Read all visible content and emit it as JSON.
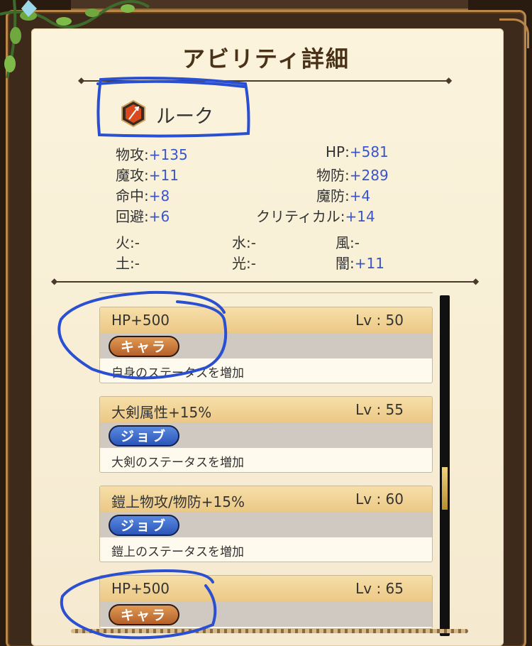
{
  "title": "アビリティ詳細",
  "character": {
    "name": "ルーク",
    "icon": "weapon-emblem-icon"
  },
  "stats_left": [
    {
      "label": "物攻:",
      "value": "+135"
    },
    {
      "label": "魔攻:",
      "value": "+11"
    },
    {
      "label": "命中:",
      "value": "+8"
    },
    {
      "label": "回避:",
      "value": "+6"
    }
  ],
  "stats_right": [
    {
      "label": "HP:",
      "value": "+581"
    },
    {
      "label": "物防:",
      "value": "+289"
    },
    {
      "label": "魔防:",
      "value": "+4"
    },
    {
      "label": "クリティカル:",
      "value": "+14"
    }
  ],
  "elements": [
    {
      "label": "火:",
      "value": "-"
    },
    {
      "label": "水:",
      "value": "-"
    },
    {
      "label": "風:",
      "value": "-"
    },
    {
      "label": "土:",
      "value": "-"
    },
    {
      "label": "光:",
      "value": "-"
    },
    {
      "label": "闇:",
      "value": "+11"
    }
  ],
  "abilities": [
    {
      "name": "HP+500",
      "lv": "Lv : 50",
      "tag": "キャラ",
      "tag_type": "chara",
      "desc": "自身のステータスを増加"
    },
    {
      "name": "大剣属性+15%",
      "lv": "Lv : 55",
      "tag": "ジョブ",
      "tag_type": "job",
      "desc": "大剣のステータスを増加"
    },
    {
      "name": "鎧上物攻/物防+15%",
      "lv": "Lv : 60",
      "tag": "ジョブ",
      "tag_type": "job",
      "desc": "鎧上のステータスを増加"
    },
    {
      "name": "HP+500",
      "lv": "Lv : 65",
      "tag": "キャラ",
      "tag_type": "chara",
      "desc": ""
    }
  ],
  "colors": {
    "value_blue": "#3a55c9",
    "annotation_blue": "#2a4fd0",
    "chara_tag": "#c46e32",
    "job_tag": "#3a66c8"
  }
}
